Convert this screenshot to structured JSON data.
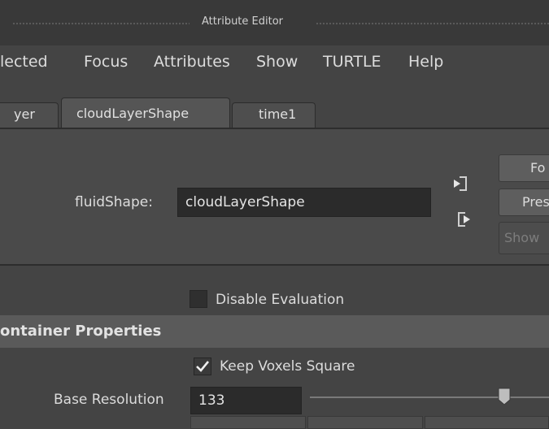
{
  "window": {
    "title": "Attribute Editor"
  },
  "menu": {
    "items": [
      "lected",
      "Focus",
      "Attributes",
      "Show",
      "TURTLE",
      "Help"
    ]
  },
  "tabs": [
    {
      "label": "yer",
      "active": false
    },
    {
      "label": "cloudLayerShape",
      "active": true
    },
    {
      "label": "time1",
      "active": false
    }
  ],
  "header": {
    "node_type_label": "fluidShape:",
    "node_name": "cloudLayerShape",
    "buttons": {
      "focus": "Fo",
      "presets": "Pres",
      "show": "Show"
    },
    "icons": {
      "input_connection": "input-connection-icon",
      "output_connection": "output-connection-icon"
    }
  },
  "options": {
    "disable_evaluation": {
      "label": "Disable Evaluation",
      "checked": false
    }
  },
  "section": {
    "title": "ontainer Properties",
    "keep_voxels_square": {
      "label": "Keep Voxels Square",
      "checked": true
    },
    "base_resolution": {
      "label": "Base Resolution",
      "value": "133"
    }
  },
  "colors": {
    "background": "#444444",
    "field": "#2b2b2b",
    "section_header": "#5a5a5a",
    "text": "#d6d6d6"
  }
}
